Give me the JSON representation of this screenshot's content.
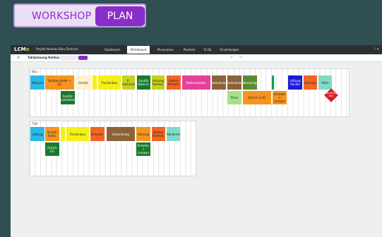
{
  "header": {
    "workshop": "WORKSHOP",
    "plan": "PLAN"
  },
  "app": {
    "logo_main": "LCM",
    "logo_mark": "o",
    "project": "Projekt Neubau Büro Zentrum",
    "nav": [
      "Dashboard",
      "Whiteboard",
      "Phasenplan",
      "Planliste",
      "To Do",
      "Einstellungen"
    ],
    "active_nav": "Whiteboard",
    "icons": "?  ⚙",
    "menu_icon": "≡",
    "board_title": "Taktplanung Rohbau",
    "undo_icon": "↶",
    "redo_icon": "↷"
  },
  "sections": [
    {
      "label": "Bau"
    },
    {
      "label": "TGA"
    }
  ],
  "cards": {
    "c1": "Abbruch",
    "c2": "Rohbau Keller + EG",
    "c3": "Gerüst",
    "c4": "Trockenbau",
    "c5": "E-Rohinstall.",
    "c6": "Estrich",
    "c7": "Sanitär Rohinst.",
    "c8": "Heizung Rohinst.",
    "c9": "Elektro Rohinst.",
    "c10": "Putz",
    "c11": "Malerarbeiten",
    "c12": "Fliesen",
    "c13": "Bodenbelag",
    "c14": "Türen",
    "c15": "Fenster",
    "c16": "Außenanlagen",
    "c17": "Lüftung Kanäle",
    "c18": "Fassade",
    "c19": "Endreinigung",
    "c20": "Estrich 2.OG",
    "c21": "Schalter + Lampen",
    "c22": "Lüftung",
    "c23": "Sanitär Endm.",
    "c24": "Heizkörper",
    "c25": "Estrich EG",
    "c26": "Trockenbau",
    "c27": "E-Install.",
    "c28": "Bodenbelag",
    "c29": "Heizung",
    "c30": "Lüftung",
    "c31": "Abnahme",
    "c32": "Schalter + Lampen",
    "c33": "Sanitär Installation",
    "c34": "Kälte",
    "c35": "Brandschutz"
  },
  "milestone": "Abnahme Bau"
}
